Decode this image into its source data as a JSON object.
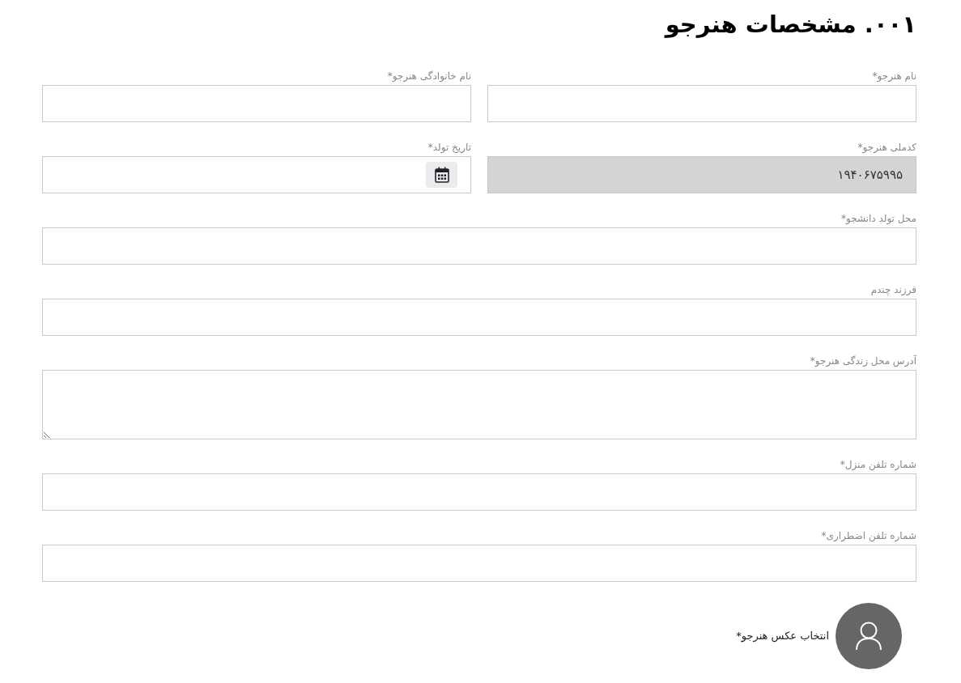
{
  "title": "۰۰۱. مشخصات هنرجو",
  "rows": [
    [
      {
        "kind": "text",
        "label": "نام هنرجو*",
        "disabled": false
      },
      {
        "kind": "text",
        "label": "نام خانوادگی هنرجو*",
        "disabled": false
      }
    ],
    [
      {
        "kind": "text",
        "label": "کدملی هنرجو*",
        "value": "۱۹۴۰۶۷۵۹۹۵",
        "disabled": true
      },
      {
        "kind": "date",
        "label": "تاریخ تولد*",
        "disabled": false
      }
    ],
    [
      {
        "kind": "text",
        "label": "محل تولد دانشجو*",
        "disabled": false
      }
    ],
    [
      {
        "kind": "text",
        "label": "فرزند چندم",
        "disabled": false
      }
    ],
    [
      {
        "kind": "textarea",
        "label": "آدرس محل زندگی هنرجو*",
        "disabled": false
      }
    ],
    [
      {
        "kind": "text",
        "label": "شماره تلفن منزل*",
        "disabled": false
      }
    ],
    [
      {
        "kind": "text",
        "label": "شماره تلفن اضطراری*",
        "disabled": false
      }
    ]
  ],
  "photo": {
    "label": "انتخاب عکس هنرجو*"
  }
}
